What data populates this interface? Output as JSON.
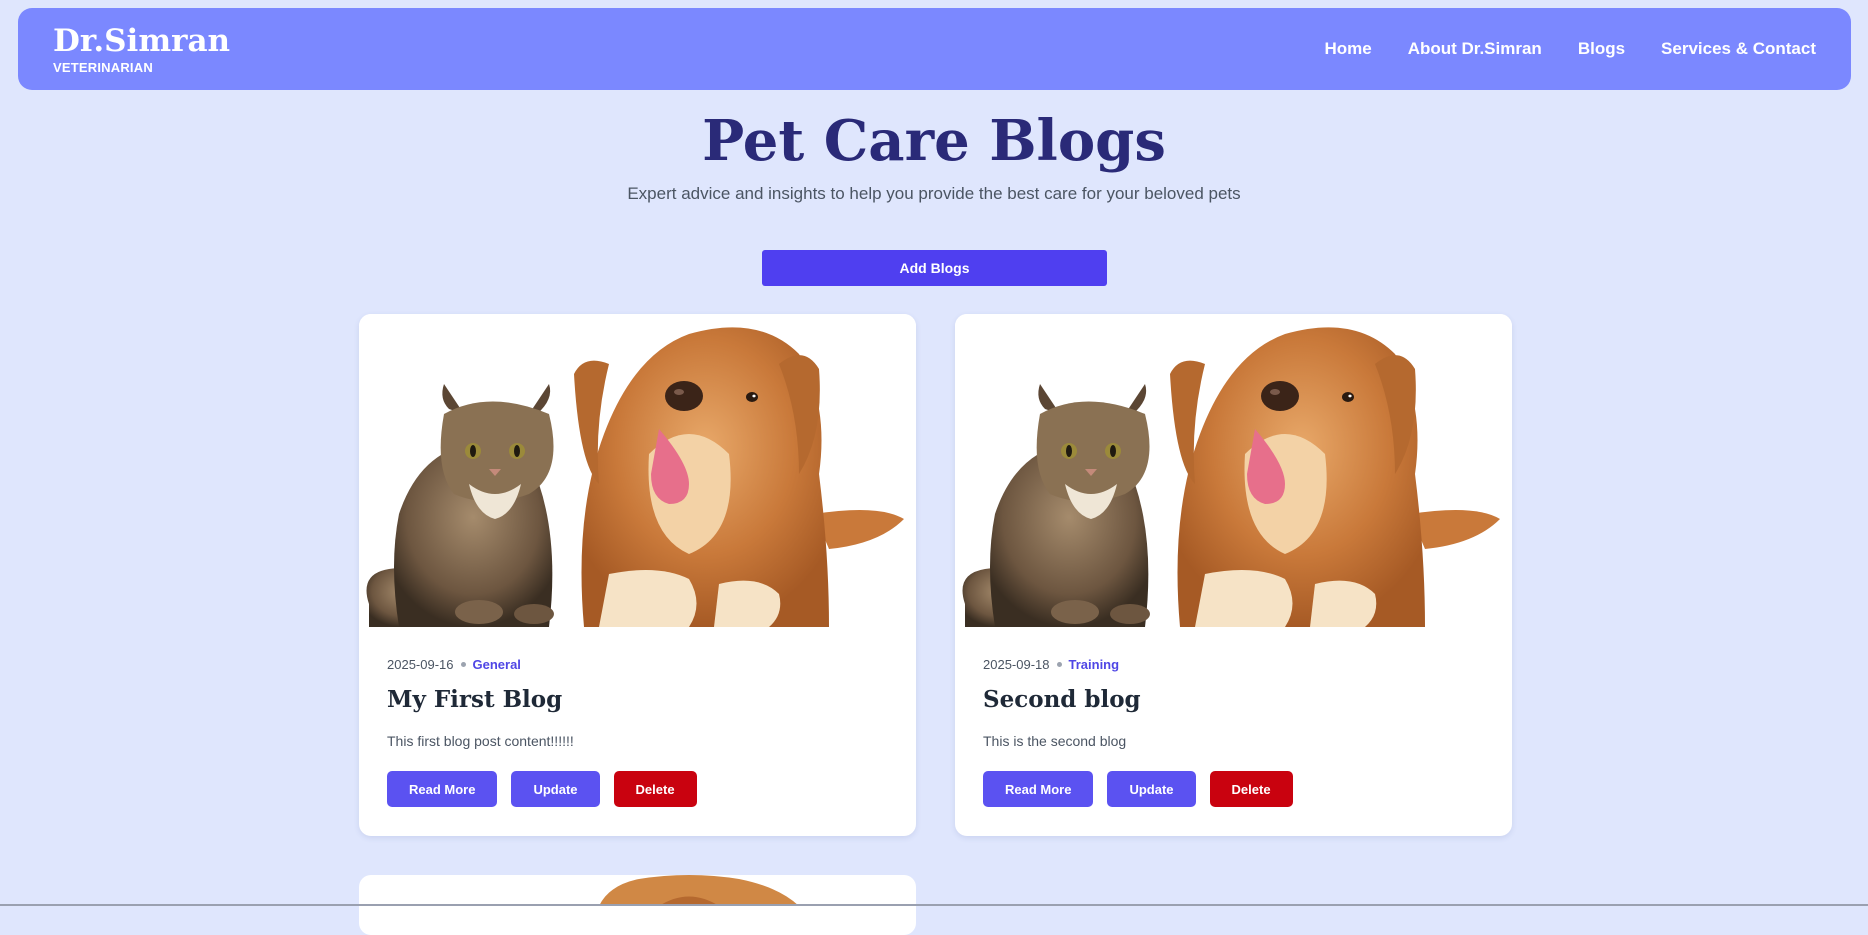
{
  "brand": {
    "name": "Dr.Simran",
    "subtitle": "VETERINARIAN"
  },
  "nav": {
    "items": [
      "Home",
      "About Dr.Simran",
      "Blogs",
      "Services & Contact"
    ]
  },
  "header": {
    "title": "Pet Care Blogs",
    "subtitle": "Expert advice and insights to help you provide the best care for your beloved pets"
  },
  "add_button": "Add Blogs",
  "blogs": [
    {
      "date": "2025-09-16",
      "category": "General",
      "title": "My First Blog",
      "excerpt": "This first blog post content!!!!!!",
      "image": "cat-and-dog-photo"
    },
    {
      "date": "2025-09-18",
      "category": "Training",
      "title": "Second blog",
      "excerpt": "This is the second blog",
      "image": "cat-and-dog-photo"
    }
  ],
  "buttons": {
    "read_more": "Read More",
    "update": "Update",
    "delete": "Delete"
  },
  "colors": {
    "accent": "#4f3ff0",
    "nav_bg": "#7b88ff",
    "page_bg": "#dfe6fd",
    "delete": "#c9020f",
    "title": "#2a2a78"
  }
}
